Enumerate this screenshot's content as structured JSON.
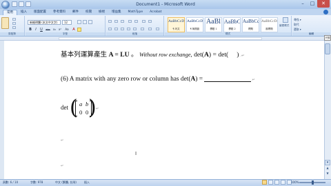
{
  "window": {
    "title": "Document1 - Microsoft Word",
    "minimize": "–",
    "maximize": "□",
    "close": "✕"
  },
  "ribbon": {
    "tabs": [
      "常用",
      "插入",
      "版面配置",
      "參考資料",
      "郵件",
      "校閱",
      "檢視",
      "增益集",
      "MathType",
      "Acrobat"
    ],
    "active_tab": "常用",
    "groups": {
      "clipboard": "剪貼簿",
      "font": "字型",
      "paragraph": "段落",
      "styles": "樣式",
      "editing": "編輯"
    },
    "font_name": "新細明體 (本文中文字)",
    "font_size": "12",
    "format_buttons": [
      "B",
      "I",
      "U",
      "abc",
      "x₂",
      "x²",
      "Aa",
      "A"
    ],
    "styles": [
      {
        "sample": "AaBbCcDc",
        "name": "¶ 內文"
      },
      {
        "sample": "AaBbCcDc",
        "name": "¶ 無間距"
      },
      {
        "sample": "AaBl",
        "name": "標題 1"
      },
      {
        "sample": "AaBbC",
        "name": "標題 2"
      },
      {
        "sample": "AaBbCc",
        "name": "標題"
      },
      {
        "sample": "AaBbCcDc",
        "name": "副標題"
      }
    ],
    "change_styles": "變更樣式",
    "editing_items": [
      "尋找 ▾",
      "取代",
      "選取 ▾"
    ]
  },
  "ruler_toggle": "尺規",
  "document": {
    "line1": {
      "chinese": "基本列運算產生",
      "formula": "A = LU",
      "bullet": "。",
      "italic": "Without row exchange,",
      "det_expr_a": "det(",
      "det_bold": "A",
      "det_expr_b": ") = det(",
      "det_end": ")",
      "mark": ".↵"
    },
    "line2": {
      "prefix": "(6) A matrix with any zero row or column has",
      "det_a": "det(",
      "det_bold": "A",
      "det_b": ") =",
      "mark": ".↵"
    },
    "det_label": "det",
    "matrix": {
      "a": "a",
      "b": "b",
      "c": "0",
      "d": "0"
    },
    "matrix_end": "↵",
    "para_mark": "↵",
    "cursor": "I"
  },
  "status": {
    "page": "頁數: 6 / 10",
    "words": "字數: 978",
    "language": "中文 (繁體, 台灣)",
    "insert": "插入",
    "zoom": "100%"
  }
}
